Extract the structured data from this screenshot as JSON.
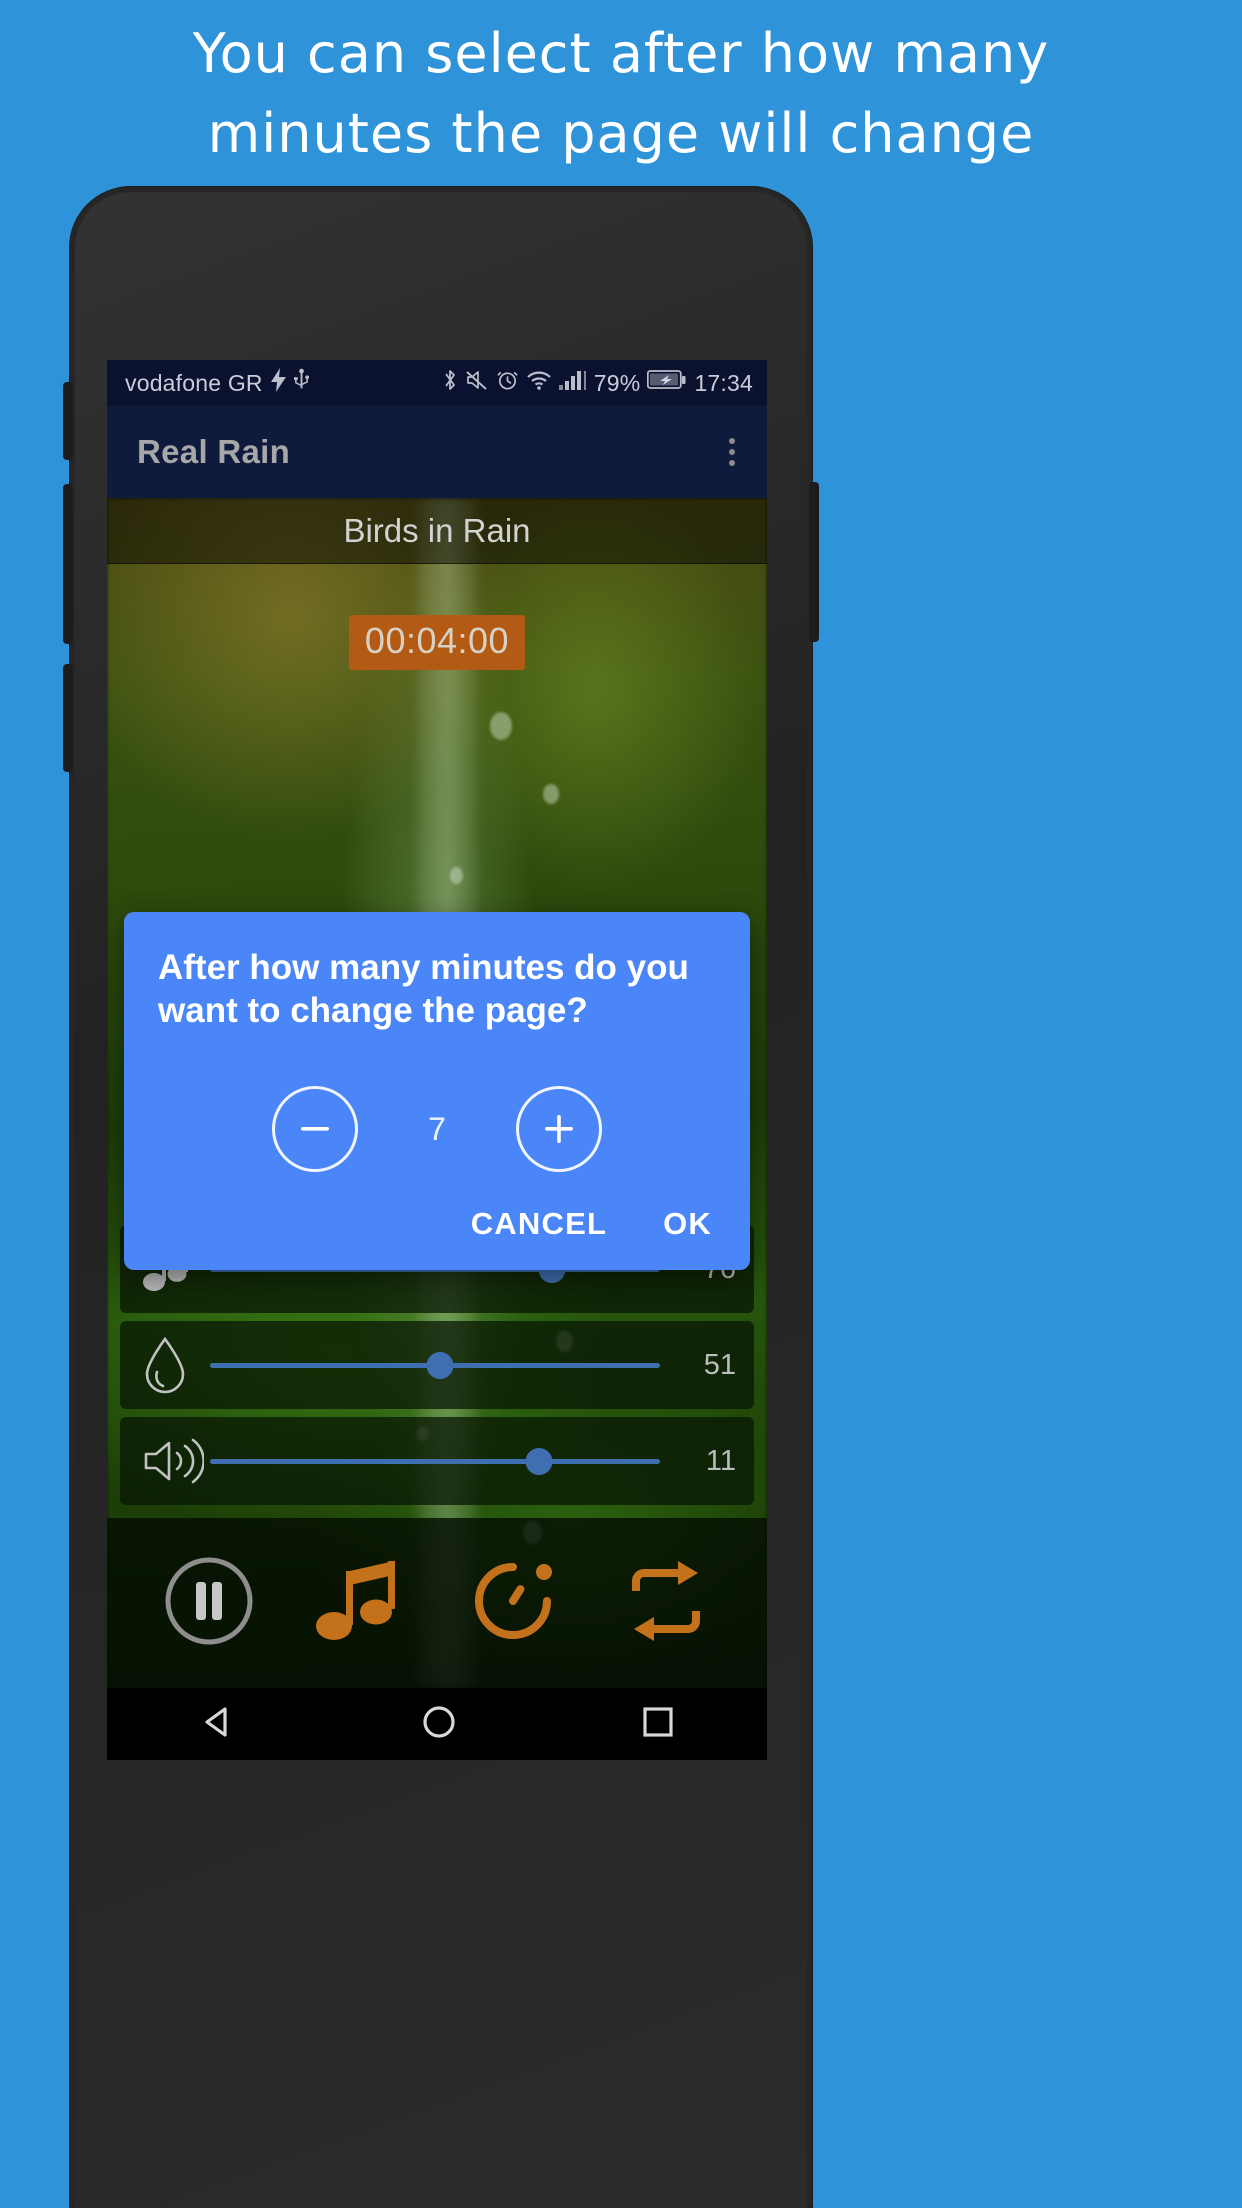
{
  "promo": {
    "lines": [
      "You can select after how many",
      "minutes the page will change"
    ],
    "bg_color": "#2e93d9"
  },
  "status_bar": {
    "carrier": "vodafone GR",
    "battery_percent": "79%",
    "time": "17:34",
    "icons": [
      "charging-bolt-icon",
      "usb-icon",
      "bluetooth-icon",
      "mute-icon",
      "alarm-icon",
      "wifi-icon",
      "signal-icon",
      "battery-icon"
    ]
  },
  "app_bar": {
    "title": "Real Rain",
    "overflow": "overflow-menu-icon"
  },
  "player": {
    "scene_title": "Birds in Rain",
    "timer": "00:04:00",
    "timer_color": "#b35a14"
  },
  "sliders": [
    {
      "icon": "music-note-icon",
      "value": "76",
      "percent": 76
    },
    {
      "icon": "water-drop-icon",
      "value": "51",
      "percent": 51
    },
    {
      "icon": "speaker-volume-icon",
      "value": "11",
      "percent": 73
    }
  ],
  "controls": [
    {
      "icon": "pause-button-icon",
      "label": "Pause"
    },
    {
      "icon": "music-library-icon",
      "label": "Sounds"
    },
    {
      "icon": "timer-icon",
      "label": "Timer"
    },
    {
      "icon": "repeat-icon",
      "label": "Repeat"
    }
  ],
  "dialog": {
    "title": "After how many minutes do you want to change the page?",
    "value": "7",
    "decrement": "minus-icon",
    "increment": "plus-icon",
    "cancel_label": "CANCEL",
    "ok_label": "OK",
    "accent": "#4a86f7"
  },
  "nav_bar": {
    "back": "back-triangle-icon",
    "home": "home-circle-icon",
    "recents": "recents-square-icon"
  }
}
